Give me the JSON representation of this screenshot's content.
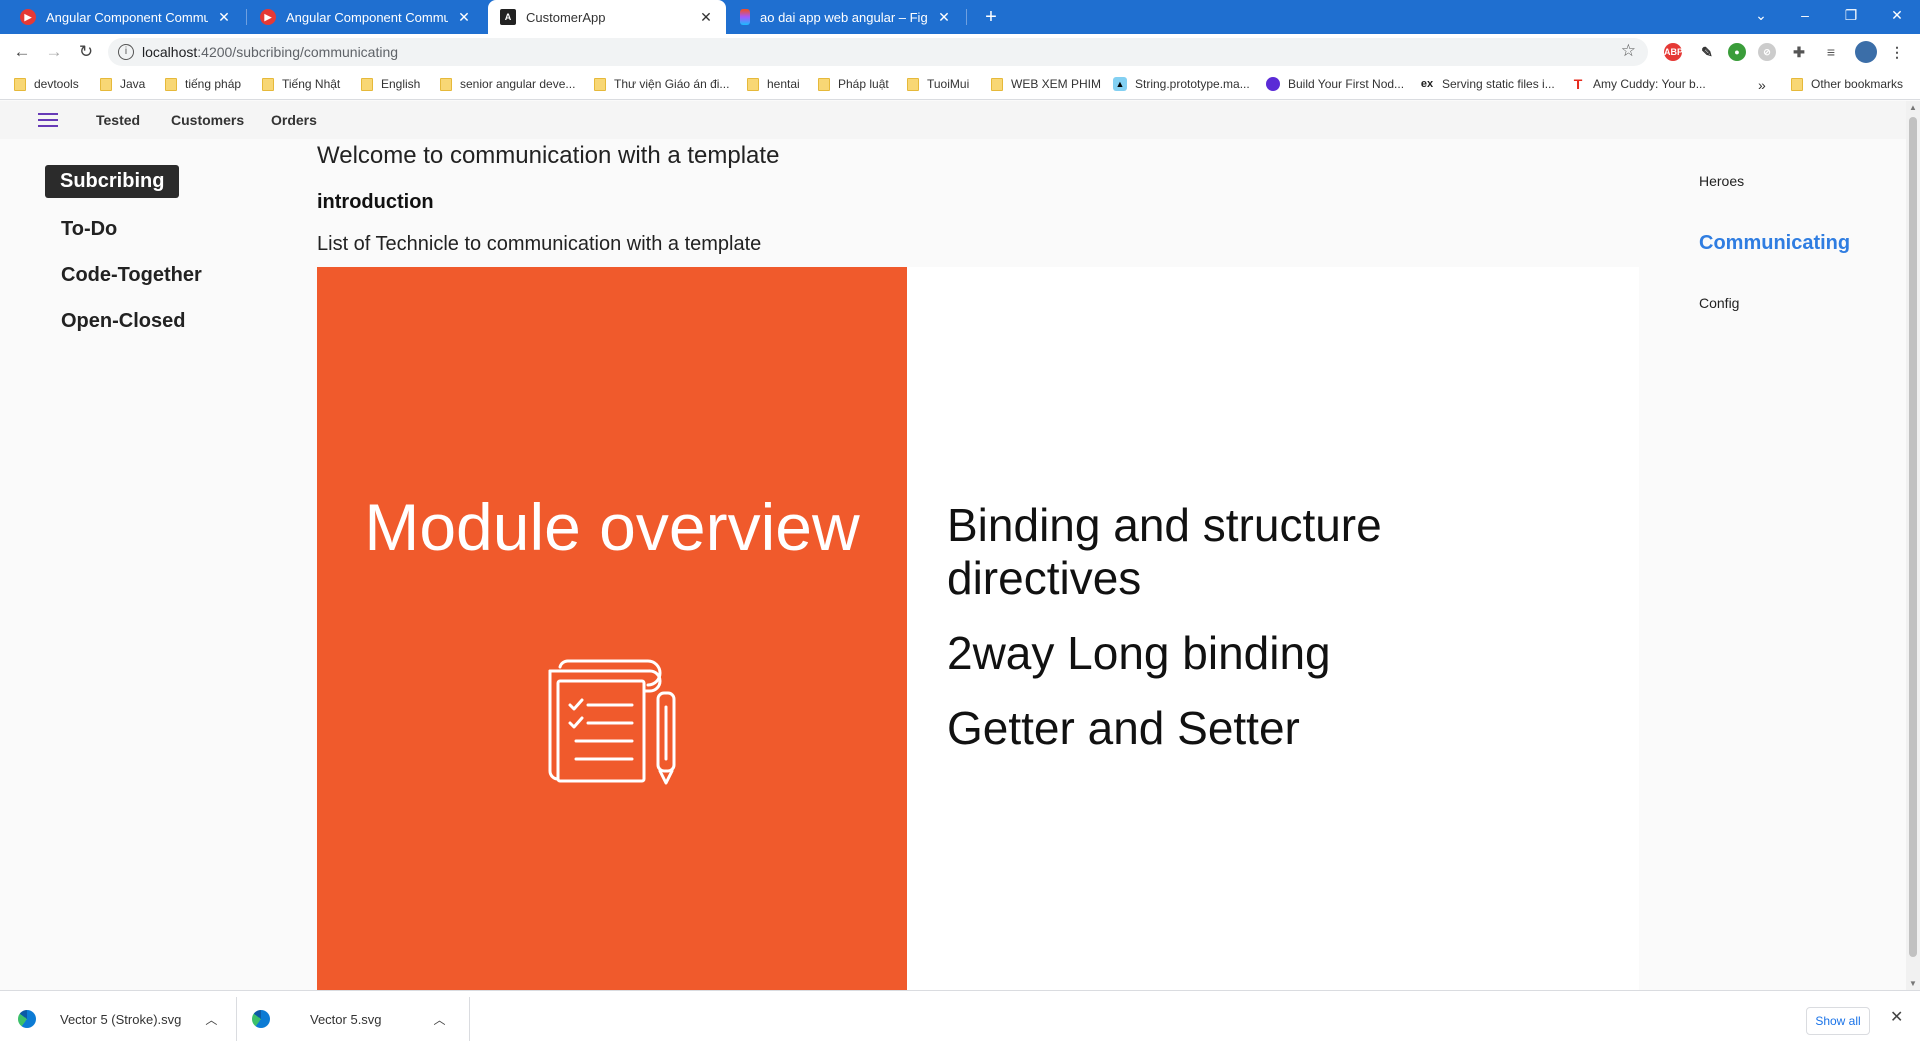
{
  "browser": {
    "tabs": [
      {
        "title": "Angular Component Communica",
        "active": false
      },
      {
        "title": "Angular Component Communica",
        "active": false
      },
      {
        "title": "CustomerApp",
        "active": true
      },
      {
        "title": "ao dai app web angular – Figma",
        "active": false
      }
    ],
    "url_host": "localhost",
    "url_rest": ":4200/subcribing/communicating",
    "bookmarks": [
      {
        "label": "devtools",
        "icon": "folder-icon"
      },
      {
        "label": "Java",
        "icon": "folder-icon"
      },
      {
        "label": "tiếng pháp",
        "icon": "folder-icon"
      },
      {
        "label": "Tiếng Nhật",
        "icon": "folder-icon"
      },
      {
        "label": "English",
        "icon": "folder-icon"
      },
      {
        "label": "senior angular deve...",
        "icon": "folder-icon"
      },
      {
        "label": "Thư viện Giáo án đi...",
        "icon": "folder-icon"
      },
      {
        "label": "hentai",
        "icon": "folder-icon"
      },
      {
        "label": "Pháp luật",
        "icon": "folder-icon"
      },
      {
        "label": "TuoiMui",
        "icon": "folder-icon"
      },
      {
        "label": "WEB XEM PHIM",
        "icon": "folder-icon"
      },
      {
        "label": "String.prototype.ma...",
        "icon": "mdn-icon"
      },
      {
        "label": "Build Your First Nod...",
        "icon": "site-icon"
      },
      {
        "label": "Serving static files i...",
        "icon": "express-icon"
      },
      {
        "label": "Amy Cuddy: Your b...",
        "icon": "ted-icon"
      }
    ],
    "other_bookmarks": "Other bookmarks",
    "overflow": "»"
  },
  "topnav": {
    "links": [
      "Tested",
      "Customers",
      "Orders"
    ]
  },
  "sidebar": {
    "items": [
      {
        "label": "Subcribing",
        "active": true
      },
      {
        "label": "To-Do",
        "active": false
      },
      {
        "label": "Code-Together",
        "active": false
      },
      {
        "label": "Open-Closed",
        "active": false
      }
    ]
  },
  "main": {
    "welcome": "Welcome to communication with a template",
    "intro": "introduction",
    "list_heading": "List of Technicle to communication with a template",
    "slide": {
      "title": "Module overview",
      "accent_color": "#f05a2c",
      "icon": "checklist-notepad-icon",
      "bullets": [
        "Binding and structure directives",
        "2way Long binding",
        "Getter and Setter"
      ]
    }
  },
  "right_nav": {
    "links": [
      {
        "label": "Heroes",
        "active": false
      },
      {
        "label": "Communicating",
        "active": true
      },
      {
        "label": "Config",
        "active": false
      }
    ]
  },
  "downloads": {
    "items": [
      {
        "name": "Vector 5 (Stroke).svg"
      },
      {
        "name": "Vector 5.svg"
      }
    ],
    "show_all": "Show all"
  }
}
